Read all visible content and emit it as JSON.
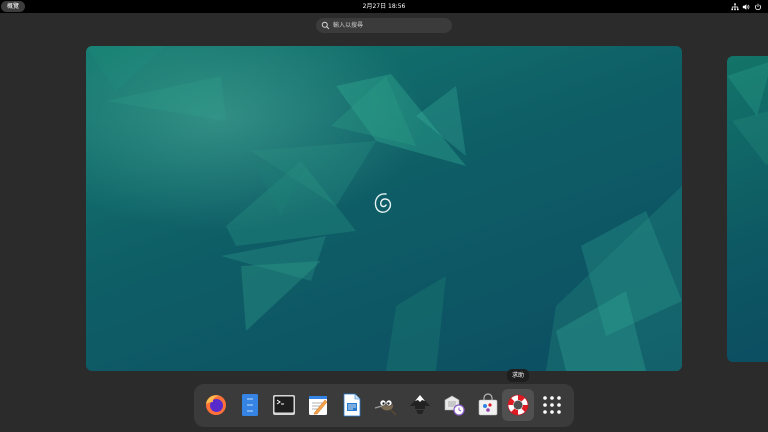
{
  "topbar": {
    "activities_label": "概覽",
    "clock": "2月27日 18:56",
    "status_icons": [
      "network-icon",
      "volume-icon",
      "power-icon"
    ]
  },
  "search": {
    "placeholder": "輸入以搜尋"
  },
  "dock": {
    "tooltip": "求助",
    "items": [
      {
        "name": "firefox-icon"
      },
      {
        "name": "files-icon"
      },
      {
        "name": "terminal-icon"
      },
      {
        "name": "text-editor-icon"
      },
      {
        "name": "libreoffice-writer-icon"
      },
      {
        "name": "gimp-icon"
      },
      {
        "name": "inkscape-icon"
      },
      {
        "name": "backup-icon"
      },
      {
        "name": "software-icon"
      },
      {
        "name": "help-icon"
      },
      {
        "name": "show-apps-icon"
      }
    ]
  },
  "colors": {
    "topbar": "#000000",
    "background": "#2b2b2b",
    "wallpaper_teal": "#14796f",
    "wallpaper_dark": "#0c4d62",
    "dock": "#3b3b3b"
  }
}
